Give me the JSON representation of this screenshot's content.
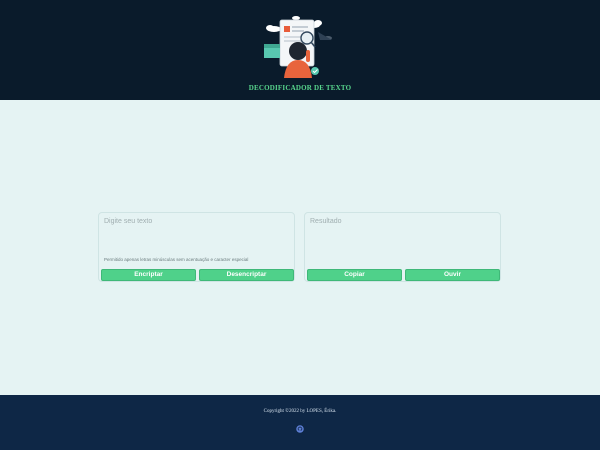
{
  "header": {
    "title": "DECODIFICADOR DE TEXTO",
    "logo_icon": "person-with-document-magnifier-illustration"
  },
  "input_panel": {
    "placeholder": "Digite seu texto",
    "hint": "Permitido apenas letras minúsculas sem acentuação e caracter especial",
    "encrypt_label": "Encriptar",
    "decrypt_label": "Desencriptar"
  },
  "output_panel": {
    "placeholder": "Resultado",
    "copy_label": "Copiar",
    "listen_label": "Ouvir"
  },
  "footer": {
    "copyright": "Copyright ©2022 by LOPES, Érika.",
    "github_icon": "github-icon"
  },
  "colors": {
    "header_bg": "#0a1b2b",
    "accent_green": "#4fd18a",
    "title_green": "#58d68d",
    "page_bg": "#e5f3f3",
    "footer_bg": "#0e2746"
  }
}
